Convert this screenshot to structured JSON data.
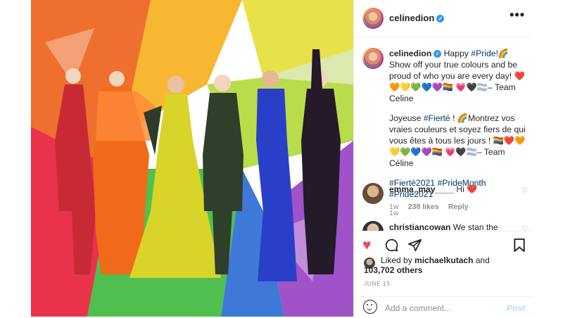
{
  "post": {
    "username": "celinedion",
    "verified_mark": "✓",
    "more": "•••",
    "image_label": "Pride collage"
  },
  "caption": {
    "username": "celinedion",
    "en_text_1": " Happy ",
    "en_tag": "#Pride!",
    "en_text_2": "🌈Show off your true colours and be proud of who you are every day! ❤️🧡💛💚💙💜🏳️‍🌈 💗🖤🏳️‍⚧️– Team Celine",
    "fr_text_1": "Joyeuse ",
    "fr_tag": "#Fierté",
    "fr_text_2": " ! 🌈Montrez vos vraies couleurs et soyez fiers de qui vous êtes à tous les jours ! 🏳️‍🌈❤️🧡💛💚💙💜🏳️‍🌈 💗🖤🏳️‍⚧️– Team Céline",
    "hashtags": [
      "#Fierté2021",
      "#PrideMonth",
      "#Pride2021"
    ],
    "age": "1w"
  },
  "comments": [
    {
      "username": "emma_may____",
      "text": " Hi ❤️",
      "age": "1w",
      "likes": "238 likes",
      "reply": "Reply"
    },
    {
      "username": "christiancowan",
      "text": " We stan the"
    }
  ],
  "actions": {
    "liked_prefix": "Liked by ",
    "liked_user": "michaelkutach",
    "liked_and": " and",
    "liked_count": "103,702 others",
    "date": "JUNE 15",
    "comment_placeholder": "Add a comment...",
    "post_label": "Post"
  },
  "colors": {
    "like_red": "#ed4956",
    "link_blue": "#00376b",
    "verified_blue": "#3897f0"
  }
}
